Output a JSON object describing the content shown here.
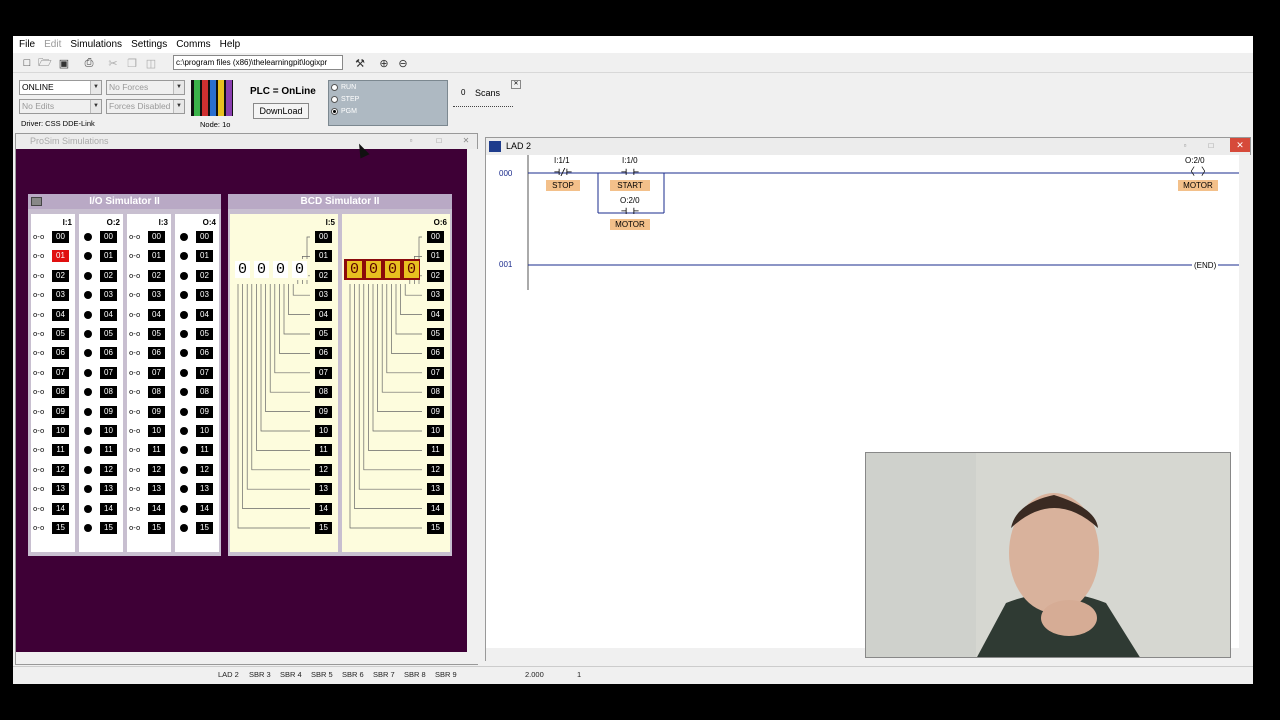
{
  "menu": [
    "File",
    "Edit",
    "Simulations",
    "Settings",
    "Comms",
    "Help"
  ],
  "toolbar": {
    "path": "c:\\program files (x86)\\thelearningpit\\logixpr"
  },
  "controls": {
    "mode_combo": "ONLINE",
    "forces_combo": "No Forces",
    "edits_combo": "No Edits",
    "forces_disabled_combo": "Forces Disabled",
    "driver": "Driver: CSS DDE-Link",
    "node": "Node: 1o",
    "plc_status": "PLC = OnLine",
    "download": "DownLoad",
    "modes": [
      "RUN",
      "STEP",
      "PGM"
    ],
    "scans_value": "0",
    "scans_label": "Scans"
  },
  "prosim": {
    "title": "ProSim Simulations",
    "io_title": "I/O Simulator II",
    "bcd_title": "BCD Simulator II",
    "io_cols": [
      "I:1",
      "O:2",
      "I:3",
      "O:4"
    ],
    "bcd_cols": [
      "I:5",
      "O:6"
    ],
    "bits": [
      "00",
      "01",
      "02",
      "03",
      "04",
      "05",
      "06",
      "07",
      "08",
      "09",
      "10",
      "11",
      "12",
      "13",
      "14",
      "15"
    ],
    "bcd_in_digits": [
      "0",
      "0",
      "0",
      "0"
    ],
    "bcd_out_digits": [
      "0",
      "0",
      "0",
      "0"
    ]
  },
  "ladder": {
    "title": "LAD 2",
    "rung0": "000",
    "rung1": "001",
    "stop_addr": "I:1/1",
    "stop_tag": "STOP",
    "start_addr": "I:1/0",
    "start_tag": "START",
    "motor_contact_addr": "O:2/0",
    "motor_contact_tag": "MOTOR",
    "coil_addr": "O:2/0",
    "coil_tag": "MOTOR",
    "end": "END"
  },
  "statusbar": {
    "tabs": [
      "LAD 2",
      "SBR 3",
      "SBR 4",
      "SBR 5",
      "SBR 6",
      "SBR 7",
      "SBR 8",
      "SBR 9"
    ],
    "value1": "2.000",
    "value2": "1"
  },
  "colors": {
    "prosim_bg": "#3e0036",
    "bit_on": "#e01010",
    "tag": "#f3c08a",
    "bcd_display": "#8b0a0a"
  }
}
